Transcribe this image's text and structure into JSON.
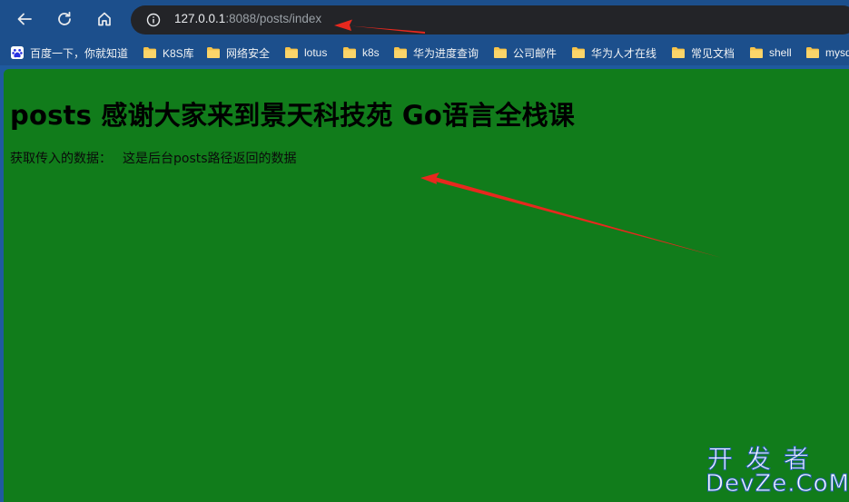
{
  "browser": {
    "url_host": "127.0.0.1",
    "url_rest": ":8088/posts/index"
  },
  "bookmarks": [
    {
      "label": "百度一下，你就知道",
      "icon": "baidu-icon"
    },
    {
      "label": "K8S库",
      "icon": "folder-icon"
    },
    {
      "label": "网络安全",
      "icon": "folder-icon"
    },
    {
      "label": "lotus",
      "icon": "folder-icon"
    },
    {
      "label": "k8s",
      "icon": "folder-icon"
    },
    {
      "label": "华为进度查询",
      "icon": "folder-icon"
    },
    {
      "label": "公司邮件",
      "icon": "folder-icon"
    },
    {
      "label": "华为人才在线",
      "icon": "folder-icon"
    },
    {
      "label": "常见文档",
      "icon": "folder-icon"
    },
    {
      "label": "shell",
      "icon": "folder-icon"
    },
    {
      "label": "mysq",
      "icon": "folder-icon"
    }
  ],
  "page": {
    "heading": "posts 感谢大家来到景天科技苑 Go语言全栈课",
    "label": "获取传入的数据：",
    "value": "这是后台posts路径返回的数据"
  },
  "watermark": {
    "line1": "开发者",
    "line2": "DevZe.CoM"
  },
  "colors": {
    "page_background": "#117c1b",
    "toolbar": "#1c4f8c",
    "omnibox": "#232428",
    "annotation_arrow": "#e8281e"
  }
}
